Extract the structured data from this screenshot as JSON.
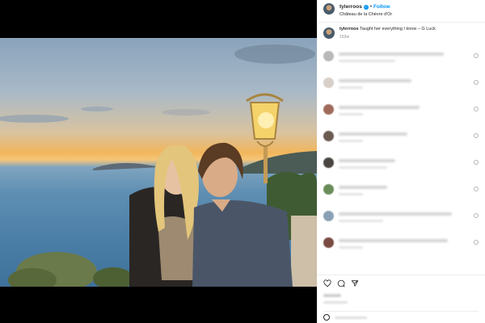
{
  "post": {
    "username": "tylerroos",
    "follow_label": "Follow",
    "location": "Château de la Chèvre d'Or",
    "separator": "•",
    "verified_mark": "✓"
  },
  "caption": {
    "username": "tylerroos",
    "text": "Taught her everything I know – G Luck",
    "time": "153w"
  },
  "comments": [
    {
      "avatar_color": "#b9b9b9",
      "lines": [
        130,
        70
      ]
    },
    {
      "avatar_color": "#d7cfc8",
      "lines": [
        90,
        30
      ]
    },
    {
      "avatar_color": "#a06b5d",
      "lines": [
        100,
        30
      ]
    },
    {
      "avatar_color": "#6b5a52",
      "lines": [
        85,
        30
      ]
    },
    {
      "avatar_color": "#4a4540",
      "lines": [
        70,
        60
      ]
    },
    {
      "avatar_color": "#6a8c58",
      "lines": [
        60,
        30
      ]
    },
    {
      "avatar_color": "#8aa0b4",
      "lines": [
        140,
        55
      ]
    },
    {
      "avatar_color": "#7a4b42",
      "lines": [
        135,
        30
      ]
    }
  ],
  "icons": [
    "heart-icon",
    "comment-icon",
    "share-icon"
  ],
  "colors": {
    "accent": "#0095f6",
    "text": "#262626",
    "muted": "#8e8e8e"
  }
}
